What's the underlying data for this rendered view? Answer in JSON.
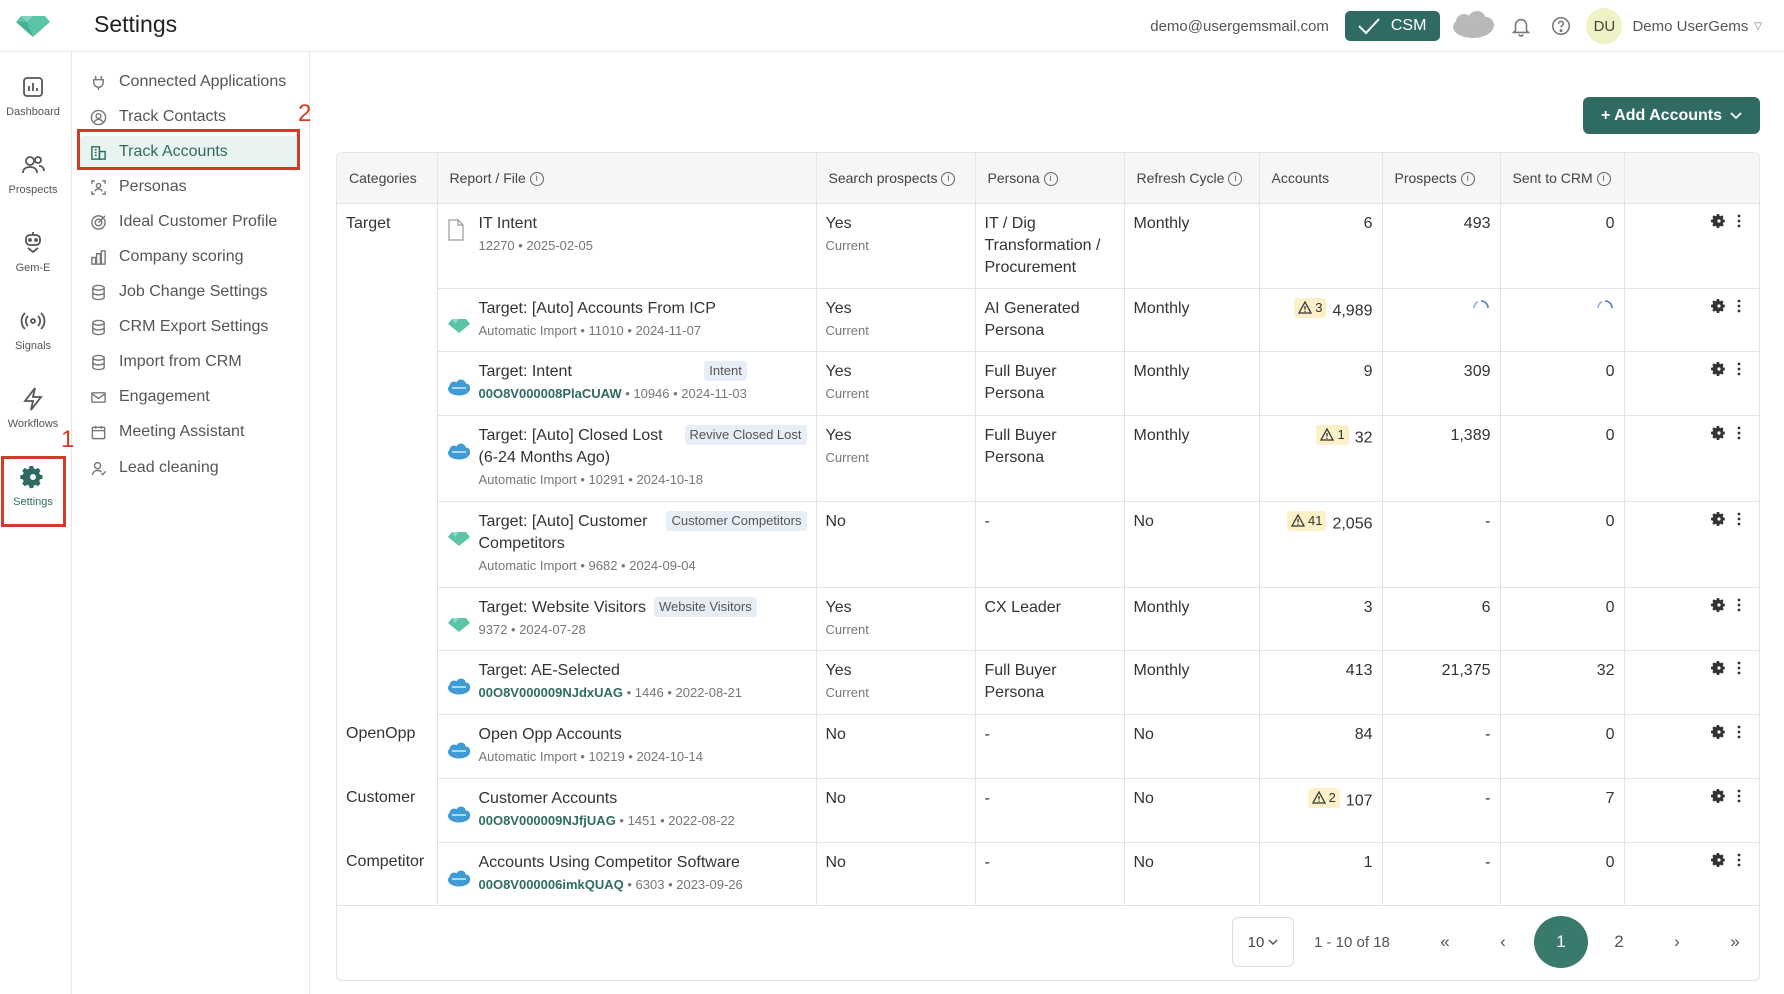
{
  "header": {
    "title": "Settings",
    "email": "demo@usergemsmail.com",
    "csm_label": "CSM",
    "avatar_initials": "DU",
    "user_name": "Demo UserGems"
  },
  "rail": [
    {
      "label": "Dashboard",
      "icon": "dashboard-icon"
    },
    {
      "label": "Prospects",
      "icon": "prospects-icon"
    },
    {
      "label": "Gem-E",
      "icon": "gem-e-icon"
    },
    {
      "label": "Signals",
      "icon": "signals-icon"
    },
    {
      "label": "Workflows",
      "icon": "workflows-icon"
    },
    {
      "label": "Settings",
      "icon": "gear-icon"
    }
  ],
  "subnav": [
    {
      "label": "Connected Applications",
      "icon": "plug-icon"
    },
    {
      "label": "Track Contacts",
      "icon": "contact-icon"
    },
    {
      "label": "Track Accounts",
      "icon": "building-icon"
    },
    {
      "label": "Personas",
      "icon": "persona-icon"
    },
    {
      "label": "Ideal Customer Profile",
      "icon": "target-icon"
    },
    {
      "label": "Company scoring",
      "icon": "bar-chart-icon"
    },
    {
      "label": "Job Change Settings",
      "icon": "database-icon"
    },
    {
      "label": "CRM Export Settings",
      "icon": "database-icon"
    },
    {
      "label": "Import from CRM",
      "icon": "database-icon"
    },
    {
      "label": "Engagement",
      "icon": "mail-icon"
    },
    {
      "label": "Meeting Assistant",
      "icon": "calendar-icon"
    },
    {
      "label": "Lead cleaning",
      "icon": "user-icon"
    }
  ],
  "annotations": {
    "one": "1",
    "two": "2"
  },
  "add_accounts_label": "+ Add Accounts",
  "table": {
    "headers": {
      "categories": "Categories",
      "report": "Report / File",
      "search": "Search prospects",
      "persona": "Persona",
      "refresh": "Refresh Cycle",
      "accounts": "Accounts",
      "prospects": "Prospects",
      "sent": "Sent to CRM"
    },
    "rows": [
      {
        "category": "Target",
        "source": "file",
        "name": "IT Intent",
        "tag": "",
        "meta_id": "",
        "meta": "12270 • 2025-02-05",
        "search": "Yes",
        "search_sub": "Current",
        "persona": "IT / Dig Transformation / Procurement",
        "refresh": "Monthly",
        "warn": "",
        "accounts": "6",
        "prospects": "493",
        "sent": "0"
      },
      {
        "category": "",
        "source": "gem",
        "name": "Target: [Auto] Accounts From ICP",
        "tag": "",
        "meta_id": "",
        "meta": "Automatic Import • 11010 • 2024-11-07",
        "search": "Yes",
        "search_sub": "Current",
        "persona": "AI Generated Persona",
        "refresh": "Monthly",
        "warn": "3",
        "accounts": "4,989",
        "prospects": "",
        "sent": ""
      },
      {
        "category": "",
        "source": "salesforce",
        "name": "Target: Intent",
        "tag": "Intent",
        "meta_id": "00O8V000008PlaCUAW",
        "meta": " • 10946 • 2024-11-03",
        "search": "Yes",
        "search_sub": "Current",
        "persona": "Full Buyer Persona",
        "refresh": "Monthly",
        "warn": "",
        "accounts": "9",
        "prospects": "309",
        "sent": "0"
      },
      {
        "category": "",
        "source": "salesforce",
        "name": "Target: [Auto] Closed Lost (6-24 Months Ago)",
        "tag": "Revive Closed Lost",
        "meta_id": "",
        "meta": "Automatic Import • 10291 • 2024-10-18",
        "search": "Yes",
        "search_sub": "Current",
        "persona": "Full Buyer Persona",
        "refresh": "Monthly",
        "warn": "1",
        "accounts": "32",
        "prospects": "1,389",
        "sent": "0"
      },
      {
        "category": "",
        "source": "gem",
        "name": "Target: [Auto] Customer Competitors",
        "tag": "Customer Competitors",
        "meta_id": "",
        "meta": "Automatic Import • 9682 • 2024-09-04",
        "search": "No",
        "search_sub": "",
        "persona": "-",
        "refresh": "No",
        "warn": "41",
        "accounts": "2,056",
        "prospects": "-",
        "sent": "0"
      },
      {
        "category": "",
        "source": "gem",
        "name": "Target: Website Visitors",
        "tag": "Website Visitors",
        "meta_id": "",
        "meta": "9372 • 2024-07-28",
        "search": "Yes",
        "search_sub": "Current",
        "persona": "CX Leader",
        "refresh": "Monthly",
        "warn": "",
        "accounts": "3",
        "prospects": "6",
        "sent": "0"
      },
      {
        "category": "",
        "source": "salesforce",
        "name": "Target: AE-Selected",
        "tag": "",
        "meta_id": "00O8V000009NJdxUAG",
        "meta": " • 1446 • 2022-08-21",
        "search": "Yes",
        "search_sub": "Current",
        "persona": "Full Buyer Persona",
        "refresh": "Monthly",
        "warn": "",
        "accounts": "413",
        "prospects": "21,375",
        "sent": "32"
      },
      {
        "category": "OpenOpp",
        "source": "salesforce",
        "name": "Open Opp Accounts",
        "tag": "",
        "meta_id": "",
        "meta": "Automatic Import • 10219 • 2024-10-14",
        "search": "No",
        "search_sub": "",
        "persona": "-",
        "refresh": "No",
        "warn": "",
        "accounts": "84",
        "prospects": "-",
        "sent": "0"
      },
      {
        "category": "Customer",
        "source": "salesforce",
        "name": "Customer Accounts",
        "tag": "",
        "meta_id": "00O8V000009NJfjUAG",
        "meta": " • 1451 • 2022-08-22",
        "search": "No",
        "search_sub": "",
        "persona": "-",
        "refresh": "No",
        "warn": "2",
        "accounts": "107",
        "prospects": "-",
        "sent": "7"
      },
      {
        "category": "Competitor",
        "source": "salesforce",
        "name": "Accounts Using Competitor Software",
        "tag": "",
        "meta_id": "00O8V000006imkQUAQ",
        "meta": " • 6303 • 2023-09-26",
        "search": "No",
        "search_sub": "",
        "persona": "-",
        "refresh": "No",
        "warn": "",
        "accounts": "1",
        "prospects": "-",
        "sent": "0"
      }
    ]
  },
  "pagination": {
    "page_size": "10",
    "range": "1 - 10 of 18",
    "first": "«",
    "prev": "‹",
    "pages": [
      "1",
      "2"
    ],
    "current": "1",
    "next": "›",
    "last": "»"
  },
  "colors": {
    "brand": "#2f6b62",
    "annotation": "#d23b2a",
    "salesforce": "#3e9bd6",
    "gem": "#5bc4a8"
  }
}
